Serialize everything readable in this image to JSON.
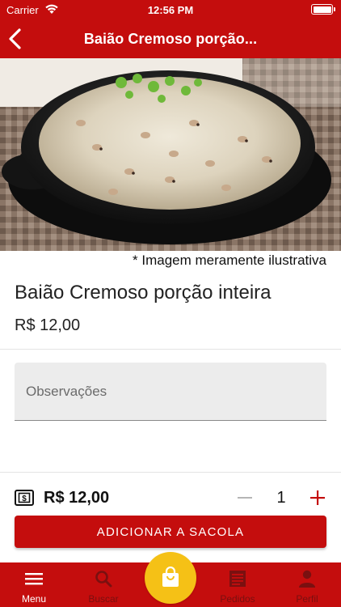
{
  "status_bar": {
    "carrier": "Carrier",
    "time": "12:56 PM"
  },
  "nav": {
    "title": "Baião Cremoso porção...",
    "back_icon": "chevron-left-icon"
  },
  "hero": {
    "caption": "* Imagem meramente ilustrativa"
  },
  "product": {
    "name": "Baião Cremoso porção inteira",
    "price": "R$ 12,00"
  },
  "observations": {
    "placeholder": "Observações",
    "value": ""
  },
  "footer": {
    "total": "R$ 12,00",
    "quantity": "1",
    "add_button": "ADICIONAR A SACOLA"
  },
  "tabbar": {
    "tabs": [
      {
        "label": "Menu",
        "icon": "menu-icon",
        "active": true
      },
      {
        "label": "Buscar",
        "icon": "search-icon",
        "active": false
      },
      {
        "label": "Pedidos",
        "icon": "orders-icon",
        "active": false
      },
      {
        "label": "Perfil",
        "icon": "profile-icon",
        "active": false
      }
    ],
    "cart_icon": "shopping-bag-icon"
  },
  "colors": {
    "brand_red": "#c40d0d",
    "cart_yellow": "#f5c116"
  }
}
